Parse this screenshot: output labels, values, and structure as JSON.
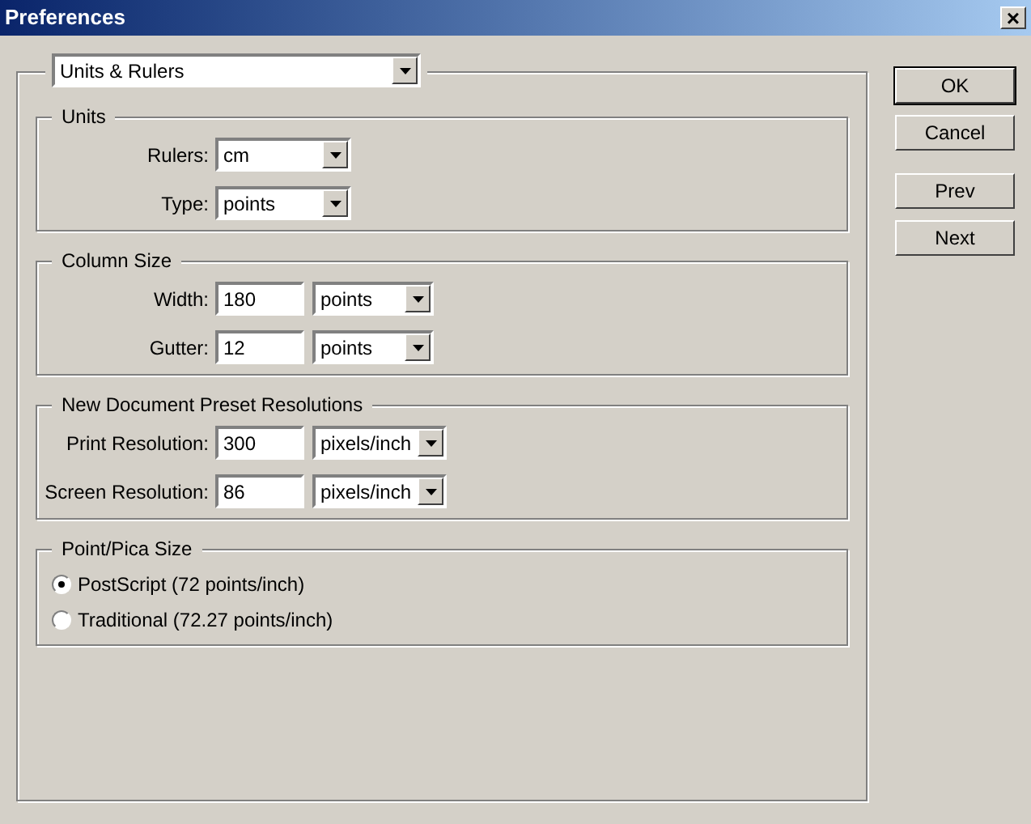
{
  "window": {
    "title": "Preferences",
    "close": "×"
  },
  "page_select": {
    "value": "Units & Rulers"
  },
  "groups": [
    {
      "title": "Units",
      "rows": [
        {
          "label": "Rulers:",
          "select": "cm"
        },
        {
          "label": "Type:",
          "select": "points"
        }
      ]
    },
    {
      "title": "Column Size",
      "rows": [
        {
          "label": "Width:",
          "input": "180",
          "select": "points"
        },
        {
          "label": "Gutter:",
          "input": "12",
          "select": "points"
        }
      ]
    },
    {
      "title": "New Document Preset Resolutions",
      "rows": [
        {
          "label": "Print Resolution:",
          "input": "300",
          "select": "pixels/inch"
        },
        {
          "label": "Screen Resolution:",
          "input": "86",
          "select": "pixels/inch"
        }
      ]
    },
    {
      "title": "Point/Pica Size",
      "radios": [
        {
          "label": "PostScript (72 points/inch)",
          "selected": true
        },
        {
          "label": "Traditional (72.27 points/inch)",
          "selected": false
        }
      ]
    }
  ],
  "buttons": [
    {
      "label": "OK",
      "default": true
    },
    {
      "label": "Cancel",
      "default": false
    },
    {
      "label": "Prev",
      "default": false
    },
    {
      "label": "Next",
      "default": false
    }
  ]
}
